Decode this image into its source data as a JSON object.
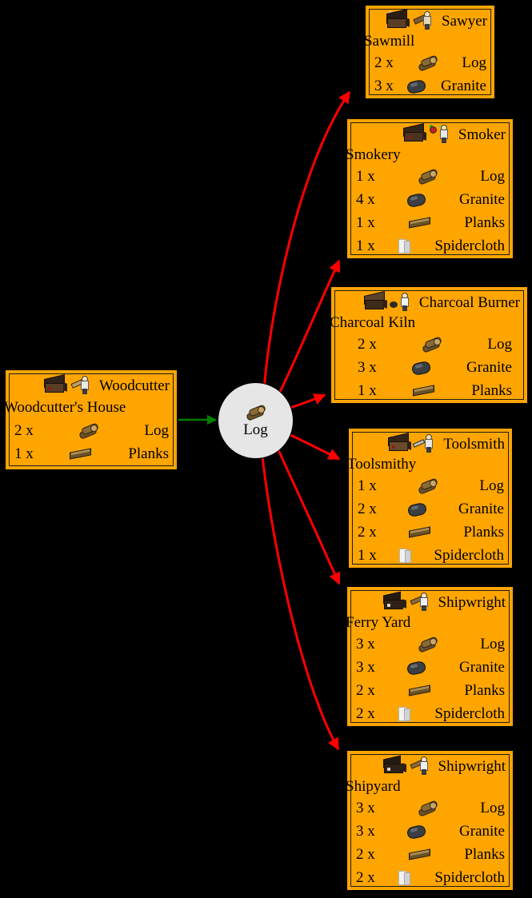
{
  "graph": {
    "title": "Log production and consumption graph",
    "background": "#000000",
    "node_fill": "#ffa500",
    "node_border": "#000000",
    "ware_fill": "#e6e6e6",
    "producer_edge_color": "#008000",
    "consumer_edge_color": "#ff0000"
  },
  "ware_node": {
    "label": "Log",
    "icon": "log-icon"
  },
  "producers": [
    {
      "id": "woodcutter",
      "worker": "Woodcutter",
      "building": "Woodcutter's House",
      "building_icon": "woodcutter-house-icon",
      "worker_icon": "woodcutter-worker-icon",
      "costs": [
        {
          "qty": "2 x",
          "icon": "log-icon",
          "material": "Log"
        },
        {
          "qty": "1 x",
          "icon": "planks-icon",
          "material": "Planks"
        }
      ]
    }
  ],
  "consumers": [
    {
      "id": "sawmill",
      "worker": "Sawyer",
      "building": "Sawmill",
      "building_icon": "sawmill-icon",
      "worker_icon": "sawyer-worker-icon",
      "costs": [
        {
          "qty": "2 x",
          "icon": "log-icon",
          "material": "Log"
        },
        {
          "qty": "3 x",
          "icon": "granite-icon",
          "material": "Granite"
        }
      ]
    },
    {
      "id": "smokery",
      "worker": "Smoker",
      "building": "Smokery",
      "building_icon": "smokery-icon",
      "worker_icon": "smoker-worker-icon",
      "costs": [
        {
          "qty": "1 x",
          "icon": "log-icon",
          "material": "Log"
        },
        {
          "qty": "4 x",
          "icon": "granite-icon",
          "material": "Granite"
        },
        {
          "qty": "1 x",
          "icon": "planks-icon",
          "material": "Planks"
        },
        {
          "qty": "1 x",
          "icon": "spidercloth-icon",
          "material": "Spidercloth"
        }
      ]
    },
    {
      "id": "charcoal_kiln",
      "worker": "Charcoal Burner",
      "building": "Charcoal Kiln",
      "building_icon": "charcoal-kiln-icon",
      "worker_icon": "charcoal-burner-worker-icon",
      "costs": [
        {
          "qty": "2 x",
          "icon": "log-icon",
          "material": "Log"
        },
        {
          "qty": "3 x",
          "icon": "granite-icon",
          "material": "Granite"
        },
        {
          "qty": "1 x",
          "icon": "planks-icon",
          "material": "Planks"
        }
      ]
    },
    {
      "id": "toolsmithy",
      "worker": "Toolsmith",
      "building": "Toolsmithy",
      "building_icon": "toolsmithy-icon",
      "worker_icon": "toolsmith-worker-icon",
      "costs": [
        {
          "qty": "1 x",
          "icon": "log-icon",
          "material": "Log"
        },
        {
          "qty": "2 x",
          "icon": "granite-icon",
          "material": "Granite"
        },
        {
          "qty": "2 x",
          "icon": "planks-icon",
          "material": "Planks"
        },
        {
          "qty": "1 x",
          "icon": "spidercloth-icon",
          "material": "Spidercloth"
        }
      ]
    },
    {
      "id": "ferry_yard",
      "worker": "Shipwright",
      "building": "Ferry Yard",
      "building_icon": "ferry-yard-icon",
      "worker_icon": "shipwright-worker-icon",
      "costs": [
        {
          "qty": "3 x",
          "icon": "log-icon",
          "material": "Log"
        },
        {
          "qty": "3 x",
          "icon": "granite-icon",
          "material": "Granite"
        },
        {
          "qty": "2 x",
          "icon": "planks-icon",
          "material": "Planks"
        },
        {
          "qty": "2 x",
          "icon": "spidercloth-icon",
          "material": "Spidercloth"
        }
      ]
    },
    {
      "id": "shipyard",
      "worker": "Shipwright",
      "building": "Shipyard",
      "building_icon": "shipyard-icon",
      "worker_icon": "shipwright-worker-icon",
      "costs": [
        {
          "qty": "3 x",
          "icon": "log-icon",
          "material": "Log"
        },
        {
          "qty": "3 x",
          "icon": "granite-icon",
          "material": "Granite"
        },
        {
          "qty": "2 x",
          "icon": "planks-icon",
          "material": "Planks"
        },
        {
          "qty": "2 x",
          "icon": "spidercloth-icon",
          "material": "Spidercloth"
        }
      ]
    }
  ]
}
